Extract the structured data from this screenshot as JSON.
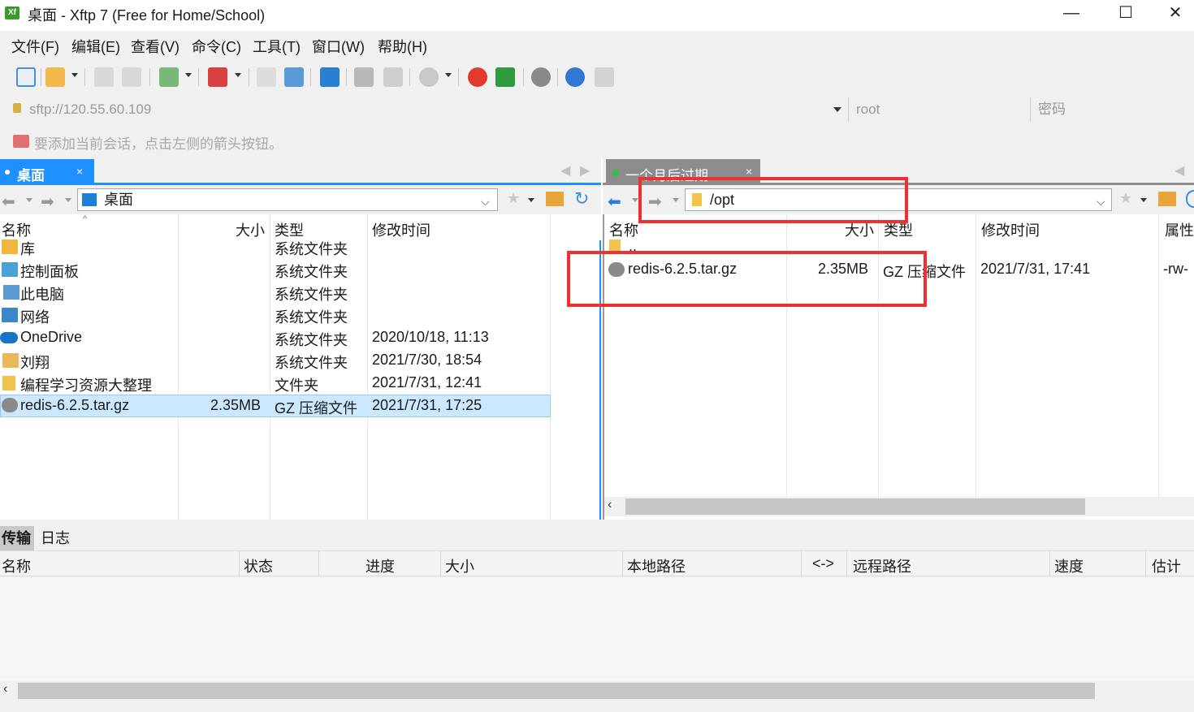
{
  "window": {
    "title": "桌面 - Xftp 7 (Free for Home/School)",
    "app_icon": "Xf",
    "minimize": "—",
    "maximize": "☐",
    "close": "✕"
  },
  "menu": [
    "文件(F)",
    "编辑(E)",
    "查看(V)",
    "命令(C)",
    "工具(T)",
    "窗口(W)",
    "帮助(H)"
  ],
  "address": {
    "host": "sftp://120.55.60.109",
    "user": "root",
    "password_placeholder": "密码"
  },
  "hint": "要添加当前会话，点击左侧的箭头按钮。",
  "left": {
    "tab_label": "桌面",
    "tab_close": "×",
    "path": "桌面",
    "columns": [
      "名称",
      "大小",
      "类型",
      "修改时间"
    ],
    "rows": [
      {
        "name": "库",
        "size": "",
        "type": "系统文件夹",
        "modified": "",
        "icon": "library-icon"
      },
      {
        "name": "控制面板",
        "size": "",
        "type": "系统文件夹",
        "modified": "",
        "icon": "control-panel-icon"
      },
      {
        "name": "此电脑",
        "size": "",
        "type": "系统文件夹",
        "modified": "",
        "icon": "computer-icon"
      },
      {
        "name": "网络",
        "size": "",
        "type": "系统文件夹",
        "modified": "",
        "icon": "network-icon"
      },
      {
        "name": "OneDrive",
        "size": "",
        "type": "系统文件夹",
        "modified": "2020/10/18, 11:13",
        "icon": "cloud-icon"
      },
      {
        "name": "刘翔",
        "size": "",
        "type": "系统文件夹",
        "modified": "2021/7/30, 18:54",
        "icon": "user-folder-icon"
      },
      {
        "name": "编程学习资源大整理",
        "size": "",
        "type": "文件夹",
        "modified": "2021/7/31, 12:41",
        "icon": "folder-icon"
      },
      {
        "name": "redis-6.2.5.tar.gz",
        "size": "2.35MB",
        "type": "GZ 压缩文件",
        "modified": "2021/7/31, 17:25",
        "icon": "archive-icon"
      }
    ]
  },
  "right": {
    "tab_label": "一个月后过期",
    "tab_close": "×",
    "path": "/opt",
    "columns": [
      "名称",
      "大小",
      "类型",
      "修改时间",
      "属性"
    ],
    "rows": [
      {
        "name": "..",
        "size": "",
        "type": "",
        "modified": "",
        "attr": "",
        "icon": "folder-icon"
      },
      {
        "name": "redis-6.2.5.tar.gz",
        "size": "2.35MB",
        "type": "GZ 压缩文件",
        "modified": "2021/7/31, 17:41",
        "attr": "-rw-",
        "icon": "archive-icon"
      }
    ]
  },
  "transfer": {
    "tabs": [
      "传输",
      "日志"
    ],
    "columns": [
      "名称",
      "状态",
      "进度",
      "大小",
      "本地路径",
      "<->",
      "远程路径",
      "速度",
      "估计剩"
    ]
  },
  "colors": {
    "accent_tab": "#1e90ff",
    "selection": "#cce8ff",
    "highlight_box": "#f03030"
  }
}
